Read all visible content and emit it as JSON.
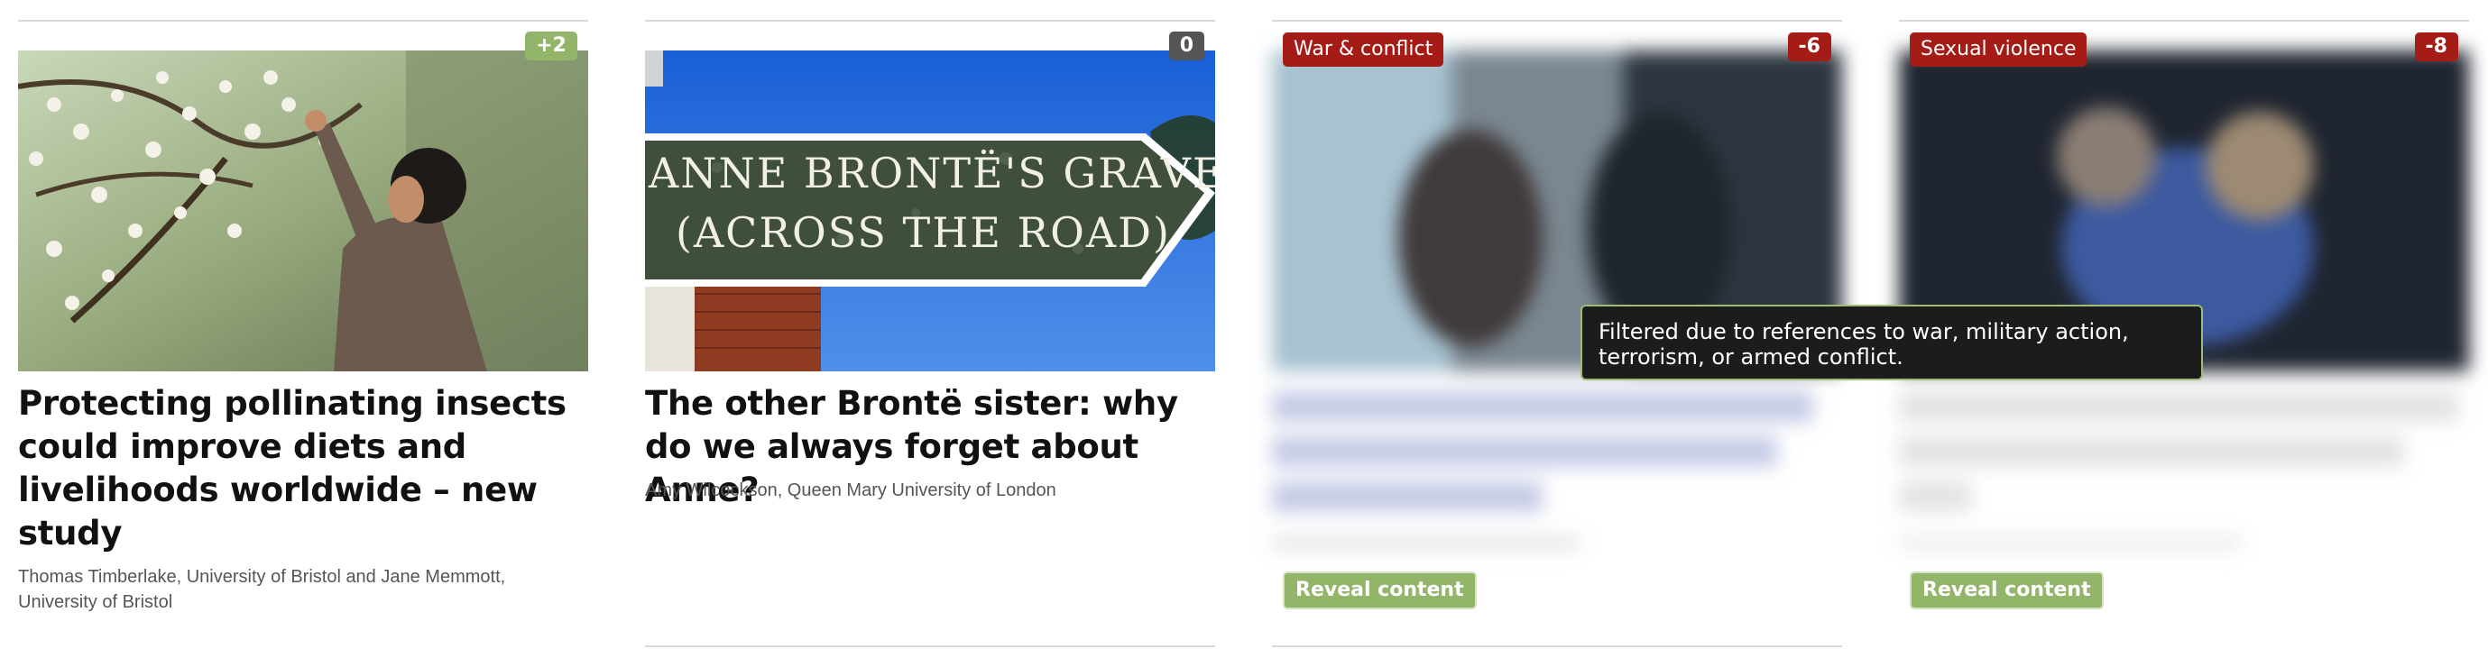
{
  "cards": [
    {
      "score": "+2",
      "score_color": "#93b56a",
      "title": "Protecting pollinating insects could improve diets and livelihoods worldwide – new study",
      "authors": "Thomas Timberlake, University of Bristol and Jane Memmott, University of Bristol"
    },
    {
      "score": "0",
      "score_color": "#555555",
      "title": "The other Brontë sister: why do we always forget about Anne?",
      "authors": "Amy Wilcockson, Queen Mary University of London",
      "sign_line1": "ANNE BRONTË'S GRAVE",
      "sign_line2": "(ACROSS THE ROAD)"
    },
    {
      "score": "-6",
      "score_color": "#a51c16",
      "category": "War & conflict",
      "reveal_label": "Reveal content"
    },
    {
      "score": "-8",
      "score_color": "#a51c16",
      "category": "Sexual violence",
      "reveal_label": "Reveal content"
    }
  ],
  "tooltip": {
    "text": "Filtered due to references to war, military action, terrorism, or armed conflict."
  }
}
